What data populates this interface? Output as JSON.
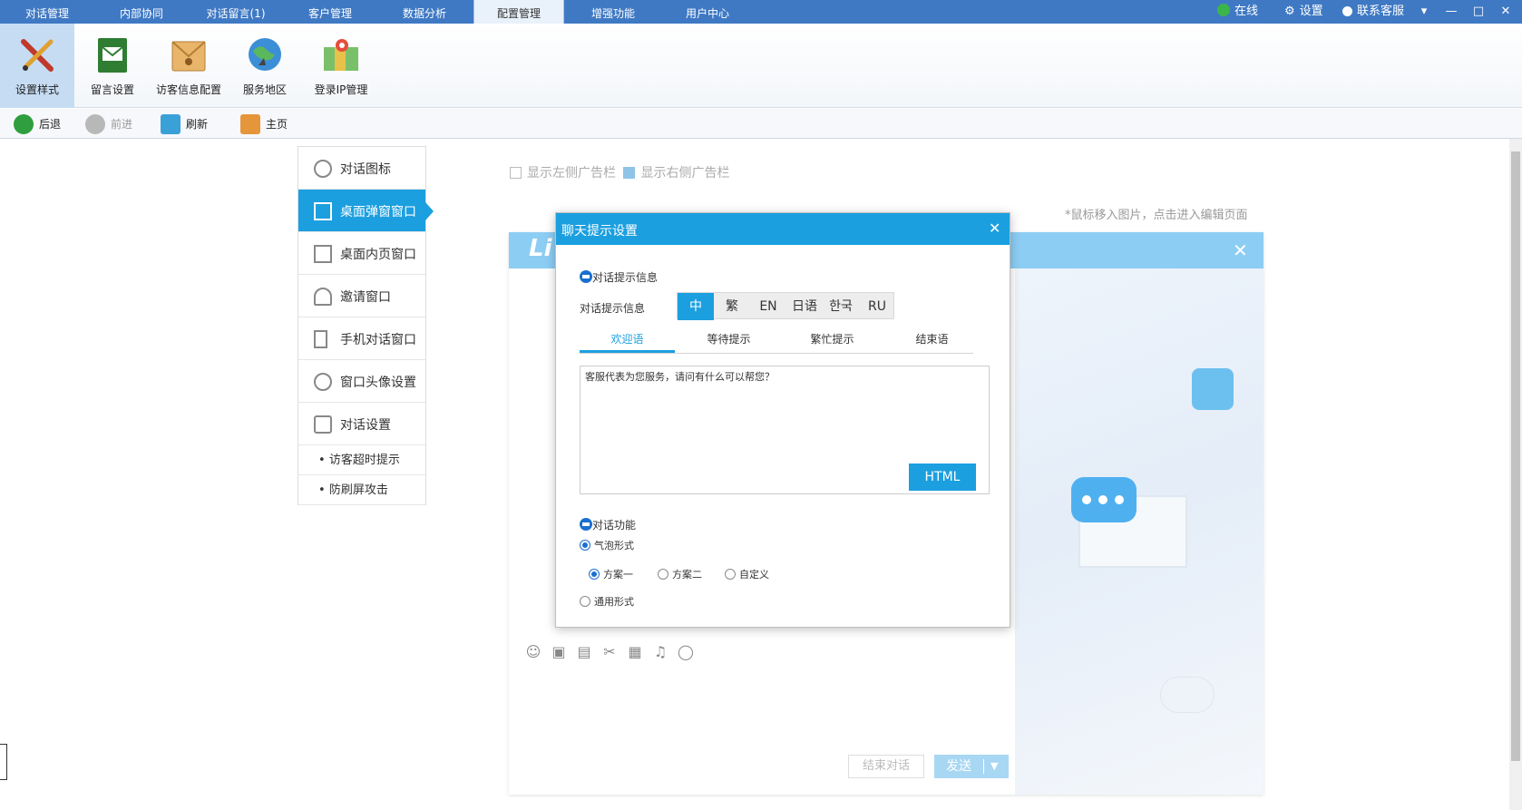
{
  "menubar": {
    "tabs": [
      "对话管理",
      "内部协同",
      "对话留言(1)",
      "客户管理",
      "数据分析",
      "配置管理",
      "增强功能",
      "用户中心"
    ],
    "active_tab": "配置管理",
    "online_label": "在线",
    "settings_label": "设置",
    "contact_label": "联系客服"
  },
  "ribbon": {
    "items": [
      "设置样式",
      "留言设置",
      "访客信息配置",
      "服务地区",
      "登录IP管理"
    ]
  },
  "navbar": {
    "back": "后退",
    "forward": "前进",
    "refresh": "刷新",
    "home": "主页"
  },
  "sidemenu": {
    "items": [
      "对话图标",
      "桌面弹窗窗口",
      "桌面内页窗口",
      "邀请窗口",
      "手机对话窗口",
      "窗口头像设置",
      "对话设置"
    ],
    "subitems": [
      "访客超时提示",
      "防刷屏攻击"
    ],
    "active": "桌面弹窗窗口"
  },
  "options": {
    "show_left_ad": "显示左侧广告栏",
    "show_right_ad": "显示右侧广告栏",
    "hint": "*鼠标移入图片，点击进入编辑页面"
  },
  "preview": {
    "logo_fragment": "Li",
    "end_chat_label": "结束对话",
    "send_label": "发送"
  },
  "modal": {
    "title": "聊天提示设置",
    "section1": "对话提示信息",
    "lang_row_label": "对话提示信息",
    "langs": [
      "中",
      "繁",
      "EN",
      "日语",
      "한국",
      "RU"
    ],
    "active_lang": "中",
    "tabs": [
      "欢迎语",
      "等待提示",
      "繁忙提示",
      "结束语"
    ],
    "active_tab": "欢迎语",
    "welcome_text": "客服代表为您服务，请问有什么可以帮您？",
    "html_button": "HTML",
    "section2": "对话功能",
    "bubble_form": "气泡形式",
    "plans": [
      "方案一",
      "方案二",
      "自定义"
    ],
    "selected_plan": "方案一",
    "general_form": "通用形式"
  },
  "colors": {
    "menubar": "#3f79c4",
    "accent": "#1b9fdf",
    "preview_header": "#8ccdf3"
  }
}
